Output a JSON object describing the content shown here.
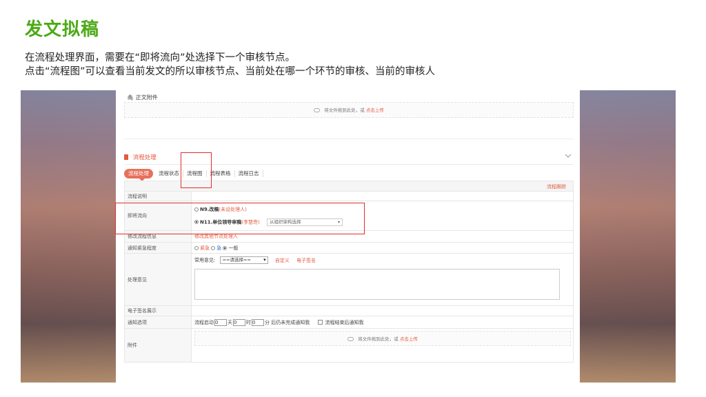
{
  "slide": {
    "title": "发文拟稿",
    "line1": "在流程处理界面，需要在“即将流向”处选择下一个审核节点。",
    "line2": "点击“流程图”可以查看当前发文的所以审核节点、当前处在哪一个环节的审核、当前的审核人"
  },
  "attachment": {
    "header": "正文附件",
    "drop_text": "将文件拖到此处，或",
    "upload_link": "点击上传"
  },
  "flow": {
    "header": "流程处理",
    "tabs": [
      {
        "label": "流程处理",
        "active": true
      },
      {
        "label": "流程状态",
        "active": false
      },
      {
        "label": "流程图",
        "active": false
      },
      {
        "label": "流程表格",
        "active": false
      },
      {
        "label": "流程日志",
        "active": false
      }
    ],
    "trace_link": "流程跟踪"
  },
  "table": {
    "rows": {
      "description": {
        "label": "流程说明"
      },
      "next_step": {
        "label": "即将流向",
        "option1_node": "N9.改稿",
        "option1_note": "(未设处理人)",
        "option2_node": "N11.单位领导审稿",
        "option2_person": "(李慧奇)",
        "option2_selected": true,
        "org_select": "从组织架构选择"
      },
      "modify": {
        "label": "修改流程信息",
        "link": "修改其他节点处理人"
      },
      "urgency": {
        "label": "通知紧急程度",
        "options": [
          "紧急",
          "急",
          "一般"
        ],
        "selected": "一般"
      },
      "opinion": {
        "label": "处理意见",
        "common_label": "常用意见:",
        "common_select": "==请选择==",
        "custom_link": "自定义",
        "esign_link": "电子签名"
      },
      "esign_display": {
        "label": "电子签名展示"
      },
      "notify": {
        "label": "通知选项",
        "text1": "流程启动",
        "text2": "天",
        "text3": "时",
        "text4": "分 后仍未完成通知我",
        "text5": "流程结束后通知我",
        "days": "0",
        "hours": "0",
        "minutes": "0"
      },
      "attach": {
        "label": "附件",
        "drop_text": "将文件拖到此处，或",
        "upload_link": "点击上传"
      }
    }
  },
  "colors": {
    "title_green": "#4caa17",
    "accent": "#e25b3e",
    "highlight": "#e52b2b"
  }
}
